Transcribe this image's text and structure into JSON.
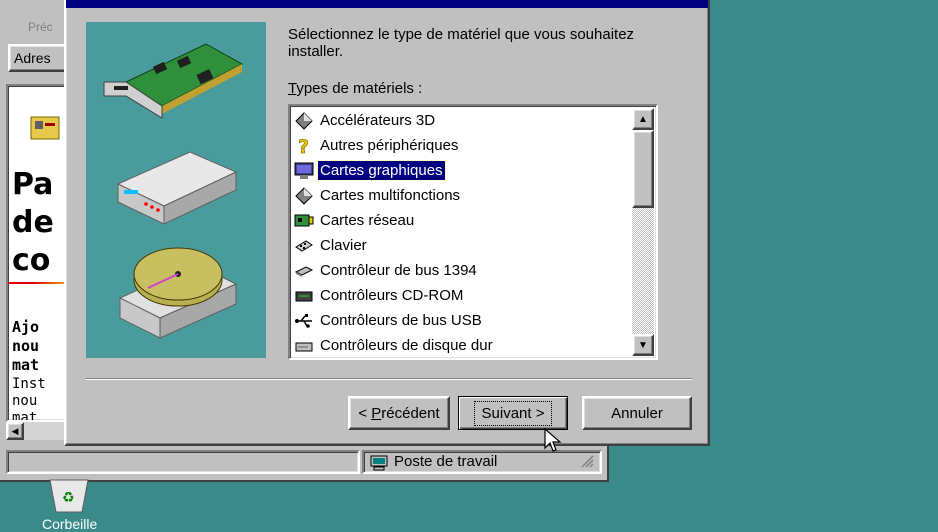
{
  "background_window": {
    "back_button_label": "Préc",
    "address_label": "Adres",
    "page_title_lines": "Pa\nde\nco",
    "subtitle_lines": "Ajo\nnou\nmat",
    "description_lines": "Inst\nnou\nmat",
    "status_location": "Poste de travail"
  },
  "desktop": {
    "recycle_bin_label": "Corbeille"
  },
  "wizard": {
    "instruction": "Sélectionnez le type de matériel que vous souhaitez installer.",
    "list_label_mnemonic": "T",
    "list_label_rest": "ypes de matériels :",
    "items": [
      {
        "label": "Accélérateurs 3D",
        "icon": "diamond-icon"
      },
      {
        "label": "Autres périphériques",
        "icon": "question-icon"
      },
      {
        "label": "Cartes graphiques",
        "icon": "monitor-icon",
        "selected": true
      },
      {
        "label": "Cartes multifonctions",
        "icon": "diamond-icon"
      },
      {
        "label": "Cartes réseau",
        "icon": "network-card-icon"
      },
      {
        "label": "Clavier",
        "icon": "keyboard-icon"
      },
      {
        "label": "Contrôleur de bus 1394",
        "icon": "bus-controller-icon"
      },
      {
        "label": "Contrôleurs CD-ROM",
        "icon": "cdrom-controller-icon"
      },
      {
        "label": "Contrôleurs de bus USB",
        "icon": "usb-icon"
      },
      {
        "label": "Contrôleurs de disque dur",
        "icon": "harddisk-controller-icon"
      }
    ],
    "buttons": {
      "prev_prefix": "< ",
      "prev_mnemonic": "P",
      "prev_rest": "récédent",
      "next": "Suivant >",
      "cancel": "Annuler"
    }
  }
}
